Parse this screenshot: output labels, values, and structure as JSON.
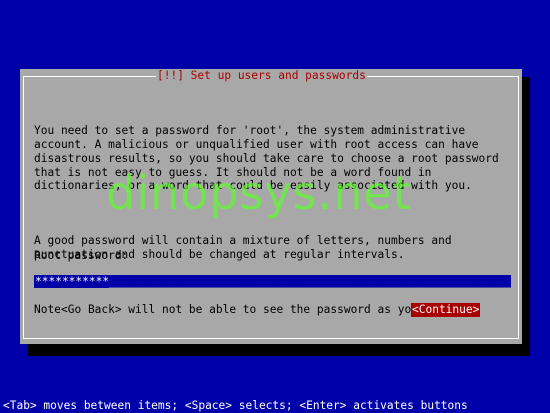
{
  "dialog": {
    "title": "[!!] Set up users and passwords",
    "paragraphs": [
      "You need to set a password for 'root', the system administrative\naccount. A malicious or unqualified user with root access can have\ndisastrous results, so you should take care to choose a root password\nthat is not easy to guess. It should not be a word found in\ndictionaries, or a word that could be easily associated with you.",
      "A good password will contain a mixture of letters, numbers and\npunctuation and should be changed at regular intervals.",
      "Note that you will not be able to see the password as you type it."
    ],
    "field_label": "Root password:",
    "password_value": "***********",
    "go_back_label": "<Go Back>",
    "continue_label": "<Continue>"
  },
  "watermark": "dinopsys.net",
  "status_bar": "<Tab> moves between items; <Space> selects; <Enter> activates buttons",
  "colors": {
    "background": "#0000a8",
    "dialog": "#a8a8a8",
    "title": "#a80000",
    "selected_button": "#a80000",
    "input": "#0000a8",
    "watermark": "#5cff28"
  }
}
